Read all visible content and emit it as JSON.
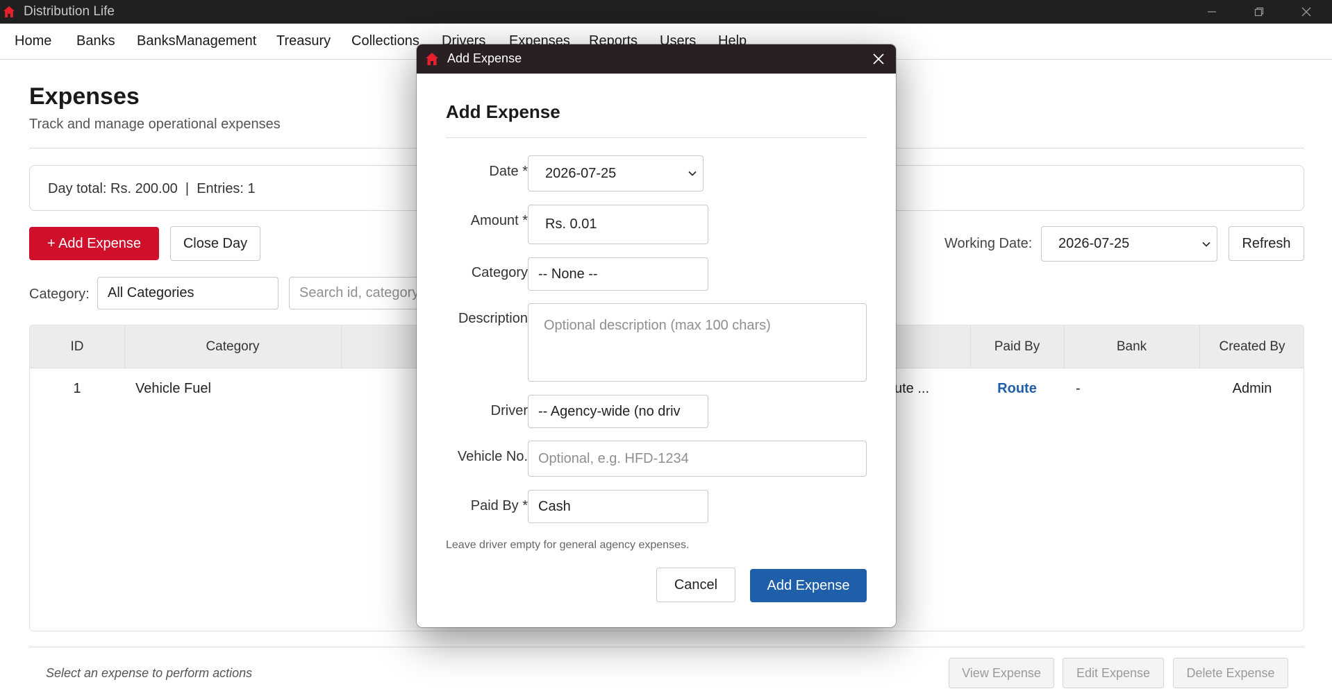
{
  "window": {
    "title": "Distribution Life"
  },
  "menu": [
    "Home",
    "Banks",
    "BanksManagement",
    "Treasury",
    "Collections",
    "Drivers",
    "Expenses",
    "Reports",
    "Users",
    "Help"
  ],
  "page": {
    "title": "Expenses",
    "subtitle": "Track and manage operational expenses",
    "summary": "Day total: Rs. 200.00  |  Entries: 1",
    "add_button": "+ Add Expense",
    "close_day_button": "Close Day",
    "working_date_label": "Working Date:",
    "working_date_value": "2026-07-25",
    "refresh_button": "Refresh",
    "category_label": "Category:",
    "category_value": "All Categories",
    "search_placeholder": "Search id, category,"
  },
  "table": {
    "columns": [
      "ID",
      "Category",
      "Paid By",
      "Bank",
      "Created By"
    ],
    "rows": [
      {
        "id": "1",
        "category": "Vehicle Fuel",
        "description": "ute ...",
        "paid_by": "Route",
        "bank": "-",
        "created_by": "Admin"
      }
    ]
  },
  "footer": {
    "hint": "Select an expense to perform actions",
    "view_button": "View Expense",
    "edit_button": "Edit Expense",
    "delete_button": "Delete Expense"
  },
  "modal": {
    "window_title": "Add Expense",
    "heading": "Add Expense",
    "date_label": "Date *",
    "date_value": "2026-07-25",
    "amount_label": "Amount *",
    "amount_value": "Rs. 0.01",
    "category_label": "Category",
    "category_value": "-- None --",
    "description_label": "Description",
    "description_placeholder": "Optional description (max 100 chars)",
    "driver_label": "Driver",
    "driver_value": "-- Agency-wide (no driv",
    "vehicle_label": "Vehicle No.",
    "vehicle_placeholder": "Optional, e.g. HFD-1234",
    "paid_by_label": "Paid By *",
    "paid_by_value": "Cash",
    "hint": "Leave driver empty for general agency expenses.",
    "cancel_button": "Cancel",
    "submit_button": "Add Expense"
  },
  "colors": {
    "accent_red": "#d0102b",
    "primary_blue": "#1f5ea8",
    "titlebar": "#202020"
  },
  "icons": [
    "home-icon",
    "minimize-icon",
    "maximize-icon",
    "close-icon",
    "chevron-down-icon"
  ]
}
